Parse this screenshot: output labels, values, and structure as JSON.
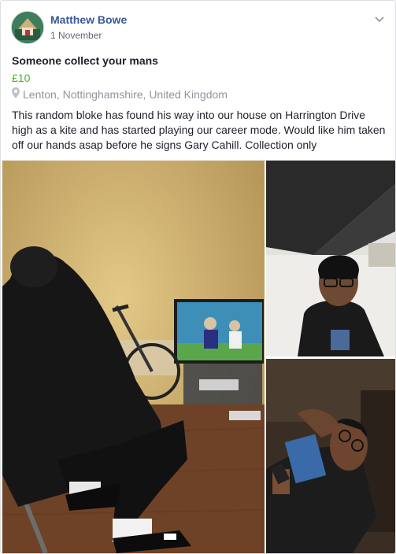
{
  "post": {
    "author": "Matthew Bowe",
    "date": "1 November",
    "title": "Someone collect your mans",
    "price": "£10",
    "location": "Lenton, Nottinghamshire, United Kingdom",
    "description": "This random bloke has found his way into our house on Harrington Drive high as a kite and has started playing our career mode. Would like him taken off our hands asap before he signs Gary Cahill. Collection only"
  },
  "icons": {
    "menu": "chevron-down-icon",
    "location": "map-pin-icon"
  },
  "colors": {
    "author_link": "#385898",
    "price": "#42b72a",
    "muted": "#90949c"
  }
}
